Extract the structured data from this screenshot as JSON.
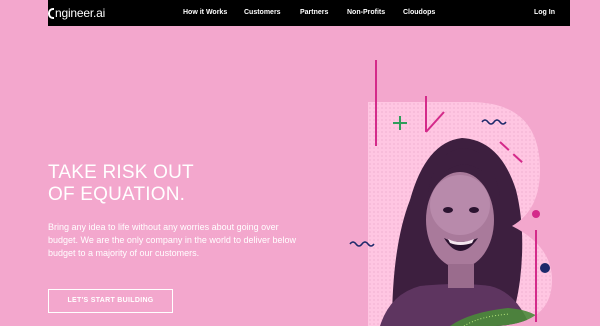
{
  "brand": {
    "logo_text": "ngineer.ai"
  },
  "nav": {
    "items": [
      {
        "label": "How it Works"
      },
      {
        "label": "Customers"
      },
      {
        "label": "Partners"
      },
      {
        "label": "Non-Profits"
      },
      {
        "label": "Cloudops"
      }
    ],
    "login_label": "Log In"
  },
  "hero": {
    "title_line1": "TAKE RISK OUT",
    "title_line2": "OF EQUATION.",
    "description": "Bring any idea to life without any worries about going over budget. We are the only company in the world to deliver below budget to a majority of our customers.",
    "cta_label": "LET'S START BUILDING"
  },
  "colors": {
    "background": "#f3a7cd",
    "navbar": "#000000",
    "letter_b": "#ffc6e2",
    "accent_magenta": "#d42a8a",
    "accent_green": "#2e9e5b",
    "accent_navy": "#1e2a6b",
    "photo_tint": "#6b3a6c"
  },
  "icons": [
    "logo-mark-icon",
    "plus-icon",
    "wave-icon"
  ]
}
